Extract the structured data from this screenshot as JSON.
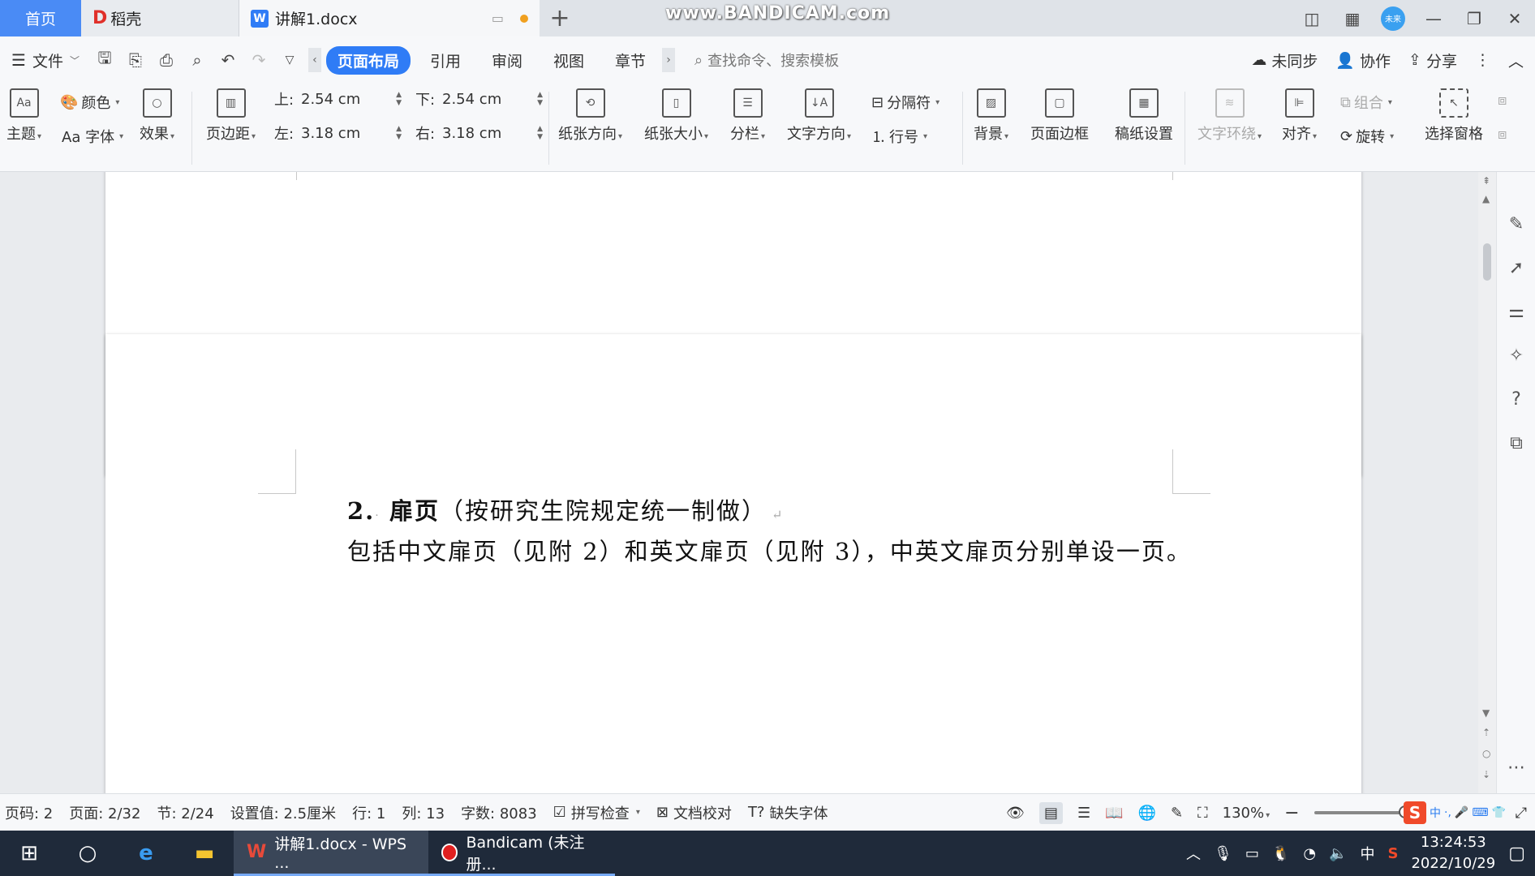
{
  "titlebar": {
    "home_tab": "首页",
    "docer_tab": "稻壳",
    "doc_tab": "讲解1.docx",
    "watermark": "www.BANDICAM.com",
    "avatar_text": "未来"
  },
  "menubar": {
    "file_label": "文件",
    "tabs": [
      "页面布局",
      "引用",
      "审阅",
      "视图",
      "章节"
    ],
    "active_tab": "页面布局",
    "search_placeholder": "查找命令、搜索模板",
    "sync_label": "未同步",
    "collab_label": "协作",
    "share_label": "分享"
  },
  "ribbon": {
    "theme": "主题",
    "color": "颜色",
    "font": "Aa 字体",
    "effect": "效果",
    "margins": "页边距",
    "margin_top_label": "上:",
    "margin_top": "2.54 cm",
    "margin_bottom_label": "下:",
    "margin_bottom": "2.54 cm",
    "margin_left_label": "左:",
    "margin_left": "3.18 cm",
    "margin_right_label": "右:",
    "margin_right": "3.18 cm",
    "orientation": "纸张方向",
    "size": "纸张大小",
    "columns": "分栏",
    "text_direction": "文字方向",
    "breaks": "分隔符",
    "line_numbers": "行号",
    "background": "背景",
    "page_border": "页面边框",
    "draft_paper": "稿纸设置",
    "text_wrap": "文字环绕",
    "align": "对齐",
    "group": "组合",
    "rotate": "旋转",
    "selection_pane": "选择窗格"
  },
  "document": {
    "line1_num": "2.",
    "line1_bold": "扉页",
    "line1_rest": "（按研究生院规定统一制做）",
    "line2": "包括中文扉页（见附 2）和英文扉页（见附 3），中英文扉页分别单设一页。"
  },
  "statusbar": {
    "page_code": "页码: 2",
    "page": "页面: 2/32",
    "section": "节: 2/24",
    "setting": "设置值: 2.5厘米",
    "row": "行: 1",
    "col": "列: 13",
    "word_count": "字数: 8083",
    "spell_check": "拼写检查",
    "doc_proof": "文档校对",
    "missing_font": "缺失字体",
    "zoom": "130%"
  },
  "taskbar": {
    "wps_app": "讲解1.docx - WPS ...",
    "bandicam_app": "Bandicam (未注册...",
    "ime": "中",
    "time": "13:24:53",
    "date": "2022/10/29"
  },
  "colors": {
    "accent": "#2f7cf6",
    "home_tab": "#4a8bf5",
    "taskbar": "#1f2a3a"
  }
}
